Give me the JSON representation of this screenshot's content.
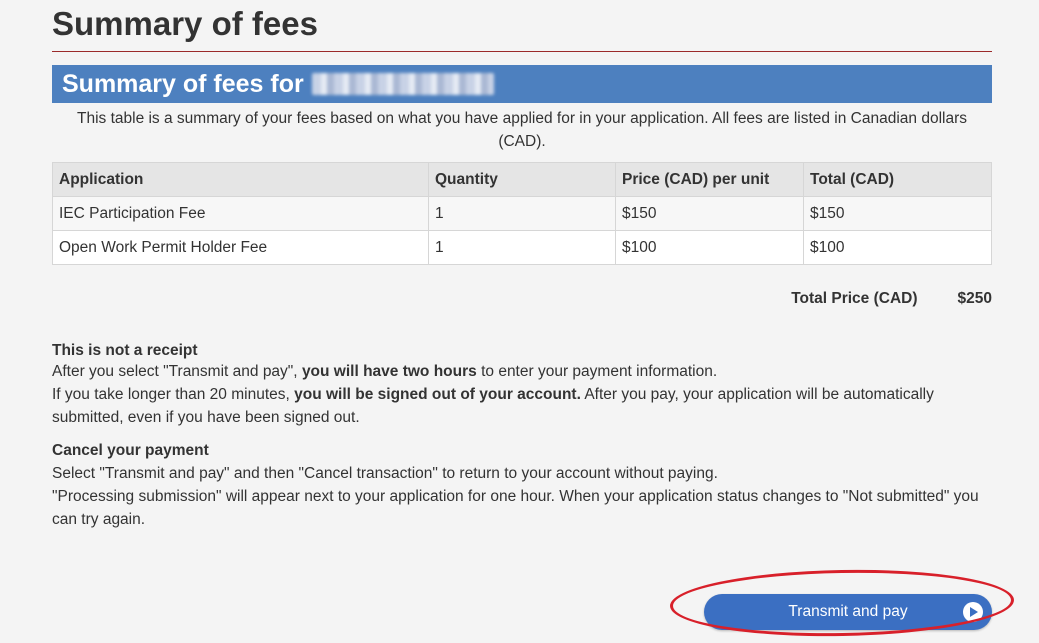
{
  "page": {
    "title": "Summary of fees"
  },
  "banner": {
    "title": "Summary of fees for"
  },
  "intro": "This table is a summary of your fees based on what you have applied for in your application. All fees are listed in Canadian dollars (CAD).",
  "fees_table": {
    "headers": [
      "Application",
      "Quantity",
      "Price (CAD) per unit",
      "Total (CAD)"
    ],
    "rows": [
      [
        "IEC Participation Fee",
        "1",
        "$150",
        "$150"
      ],
      [
        "Open Work Permit Holder Fee",
        "1",
        "$100",
        "$100"
      ]
    ]
  },
  "total": {
    "label": "Total Price (CAD)",
    "value": "$250"
  },
  "notice": {
    "title": "This is not a receipt",
    "p1_before": "After you select \"Transmit and pay\", ",
    "p1_bold": "you will have two hours",
    "p1_after": " to enter your payment information.",
    "p2_before": "If you take longer than 20 minutes, ",
    "p2_bold": "you will be signed out of your account.",
    "p2_after": " After you pay, your application will be automatically submitted, even if you have been signed out."
  },
  "cancel": {
    "title": "Cancel your payment",
    "p3": "Select \"Transmit and pay\" and then \"Cancel transaction\" to return to your account without paying.",
    "p4": "\"Processing submission\" will appear next to your application for one hour. When your application status changes to \"Not submitted\" you can try again."
  },
  "action": {
    "pay_label": "Transmit and pay"
  },
  "colors": {
    "banner": "#4d80bf",
    "button": "#3b6fc2",
    "annotation": "#d8202a",
    "rule": "#9b2a2a"
  }
}
